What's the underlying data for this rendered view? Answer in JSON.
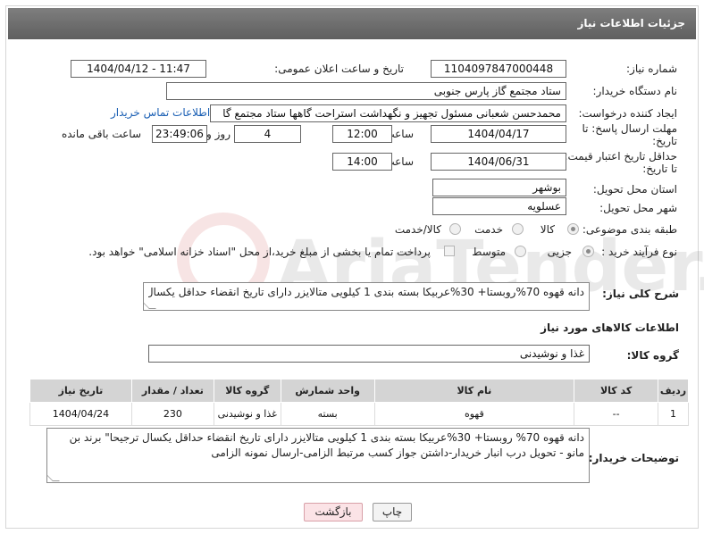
{
  "header": {
    "title": "جزئیات اطلاعات نیاز"
  },
  "need_number": {
    "label": "شماره نیاز:",
    "value": "1104097847000448"
  },
  "announce_datetime": {
    "label": "تاریخ و ساعت اعلان عمومی:",
    "value": "1404/04/12 - 11:47"
  },
  "buyer_org": {
    "label": "نام دستگاه خریدار:",
    "value": "ستاد مجتمع گاز پارس جنوبی"
  },
  "requester": {
    "label": "ایجاد کننده درخواست:",
    "value": "محمدحسن شعبانی مسئول تجهیز و نگهداشت استراحت گاهها ستاد مجتمع گا",
    "contact_link": "اطلاعات تماس خریدار"
  },
  "reply_deadline": {
    "label_line1": "مهلت ارسال پاسخ: تا",
    "label_line2": "تاریخ:",
    "date": "1404/04/17",
    "time_label": "ساعت",
    "time": "12:00",
    "days": "4",
    "days_label": "روز و",
    "remaining": "23:49:06",
    "remaining_label": "ساعت باقی مانده"
  },
  "price_validity": {
    "label_line1": "حداقل تاریخ اعتبار قیمت:",
    "label_line2": "تا تاریخ:",
    "date": "1404/06/31",
    "time_label": "ساعت",
    "time": "14:00"
  },
  "delivery_province": {
    "label": "استان محل تحویل:",
    "value": "بوشهر"
  },
  "delivery_city": {
    "label": "شهر محل تحویل:",
    "value": "عسلویه"
  },
  "category": {
    "label": "طبقه بندی موضوعی:",
    "options": [
      "کالا",
      "خدمت",
      "کالا/خدمت"
    ],
    "selected": "کالا"
  },
  "purchase_type": {
    "label": "نوع فرآیند خرید :",
    "options": [
      "جزیی",
      "متوسط"
    ],
    "selected": "جزیی",
    "note": "پرداخت تمام یا بخشی از مبلغ خرید،از محل \"اسناد خزانه اسلامی\" خواهد بود."
  },
  "description": {
    "label": "شرح کلی نیاز:",
    "value": "دانه قهوه 70%روبستا+ 30%عربیکا بسته بندی 1 کیلویی متالایزر دارای تاریخ انقضاء حداقل یکسال- برندبن مانو"
  },
  "goods_section": {
    "title": "اطلاعات کالاهای مورد نیاز"
  },
  "goods_group": {
    "label": "گروه کالا:",
    "value": "غذا و نوشیدنی"
  },
  "goods_table": {
    "headers": [
      "ردیف",
      "کد کالا",
      "نام کالا",
      "واحد شمارش",
      "گروه کالا",
      "تعداد / مقدار",
      "تاریخ نیاز"
    ],
    "rows": [
      [
        "1",
        "--",
        "قهوه",
        "بسته",
        "غذا و نوشیدنی",
        "230",
        "1404/04/24"
      ]
    ]
  },
  "buyer_notes": {
    "label": "توضیحات خریدار:",
    "value": "دانه قهوه 70% روبستا+ 30%عربیکا بسته بندی 1 کیلویی متالایزر دارای تاریخ انقضاء حداقل یکسال ترجیحا\" برند بن مانو - تحویل درب انبار خریدار-داشتن جواز کسب مرتبط الزامی-ارسال نمونه الزامی"
  },
  "buttons": {
    "print": "چاپ",
    "back": "بازگشت"
  },
  "watermark": {
    "text": "AriaTender.neT"
  }
}
